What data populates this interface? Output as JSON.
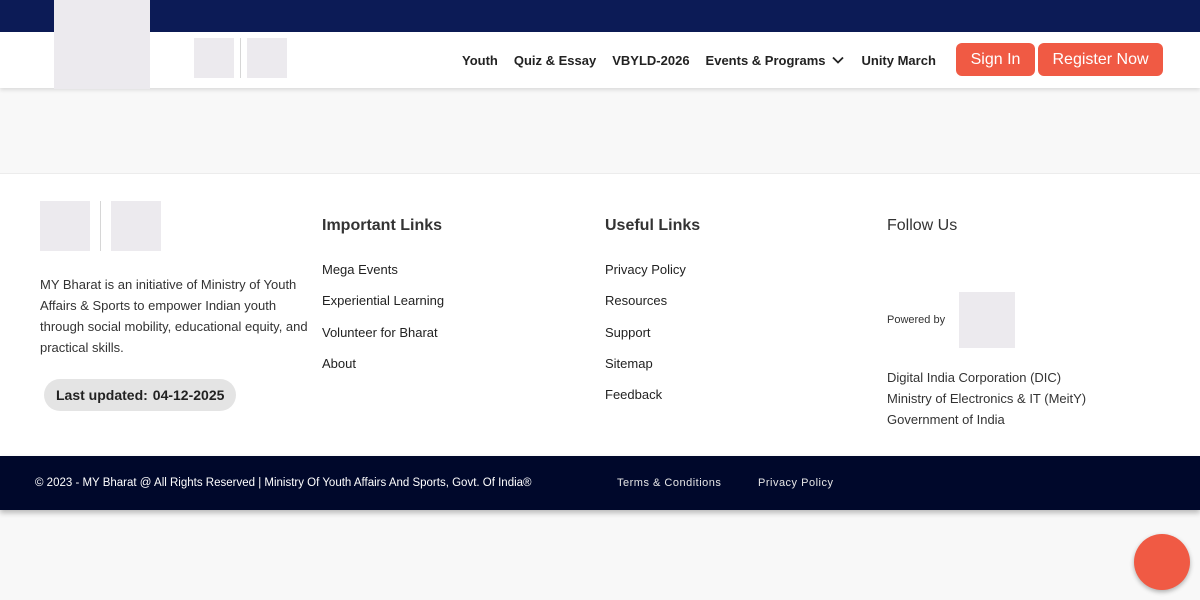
{
  "colors": {
    "topbar": "#0c1b56",
    "accent": "#f05a44",
    "bottombar": "#00082b"
  },
  "header": {
    "nav": [
      {
        "label": "Youth"
      },
      {
        "label": "Quiz & Essay"
      },
      {
        "label": "VBYLD-2026"
      },
      {
        "label": "Events & Programs",
        "icon": "chevron-down-icon"
      },
      {
        "label": "Unity March"
      }
    ],
    "sign_in": "Sign In",
    "register": "Register Now"
  },
  "footer": {
    "description": "MY Bharat is an initiative of Ministry of Youth Affairs & Sports to empower Indian youth through social mobility, educational equity, and practical skills.",
    "last_updated_label": "Last updated:",
    "last_updated_value": "04-12-2025",
    "important_links": {
      "title": "Important Links",
      "items": [
        "Mega Events",
        "Experiential Learning",
        "Volunteer for Bharat",
        "About"
      ]
    },
    "useful_links": {
      "title": "Useful Links",
      "items": [
        "Privacy Policy",
        "Resources",
        "Support",
        "Sitemap",
        "Feedback"
      ]
    },
    "follow": {
      "title": "Follow Us",
      "powered_by": "Powered by",
      "orgs": [
        "Digital India Corporation (DIC)",
        "Ministry of Electronics & IT (MeitY)",
        "Government of India"
      ]
    }
  },
  "bottom": {
    "copyright": "© 2023 - MY Bharat @ All Rights Reserved | Ministry Of Youth Affairs And Sports, Govt. Of India®",
    "terms": "Terms & Conditions",
    "privacy": "Privacy Policy"
  }
}
